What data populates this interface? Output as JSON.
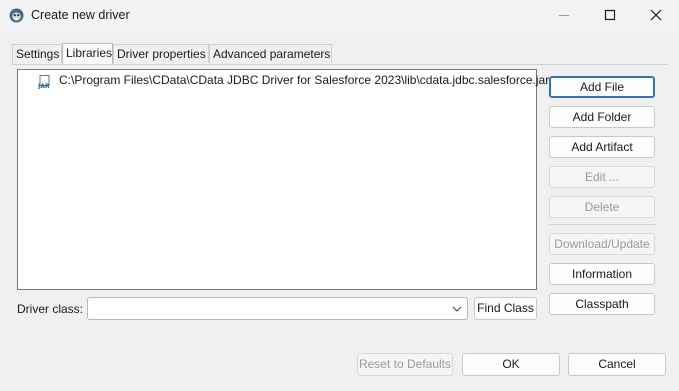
{
  "window": {
    "title": "Create new driver"
  },
  "tabs": [
    {
      "label": "Settings",
      "active": false
    },
    {
      "label": "Libraries",
      "active": true
    },
    {
      "label": "Driver properties",
      "active": false
    },
    {
      "label": "Advanced parameters",
      "active": false
    }
  ],
  "libraries": {
    "items": [
      {
        "path": "C:\\Program Files\\CData\\CData JDBC Driver for Salesforce 2023\\lib\\cdata.jdbc.salesforce.jar",
        "icon": "jar-file-icon"
      }
    ]
  },
  "side_buttons": {
    "add_file": "Add File",
    "add_folder": "Add Folder",
    "add_artifact": "Add Artifact",
    "edit": "Edit ...",
    "delete": "Delete",
    "download_update": "Download/Update",
    "information": "Information",
    "classpath": "Classpath"
  },
  "driver_class": {
    "label": "Driver class:",
    "value": "",
    "find_class": "Find Class"
  },
  "footer": {
    "reset": "Reset to Defaults",
    "ok": "OK",
    "cancel": "Cancel"
  }
}
